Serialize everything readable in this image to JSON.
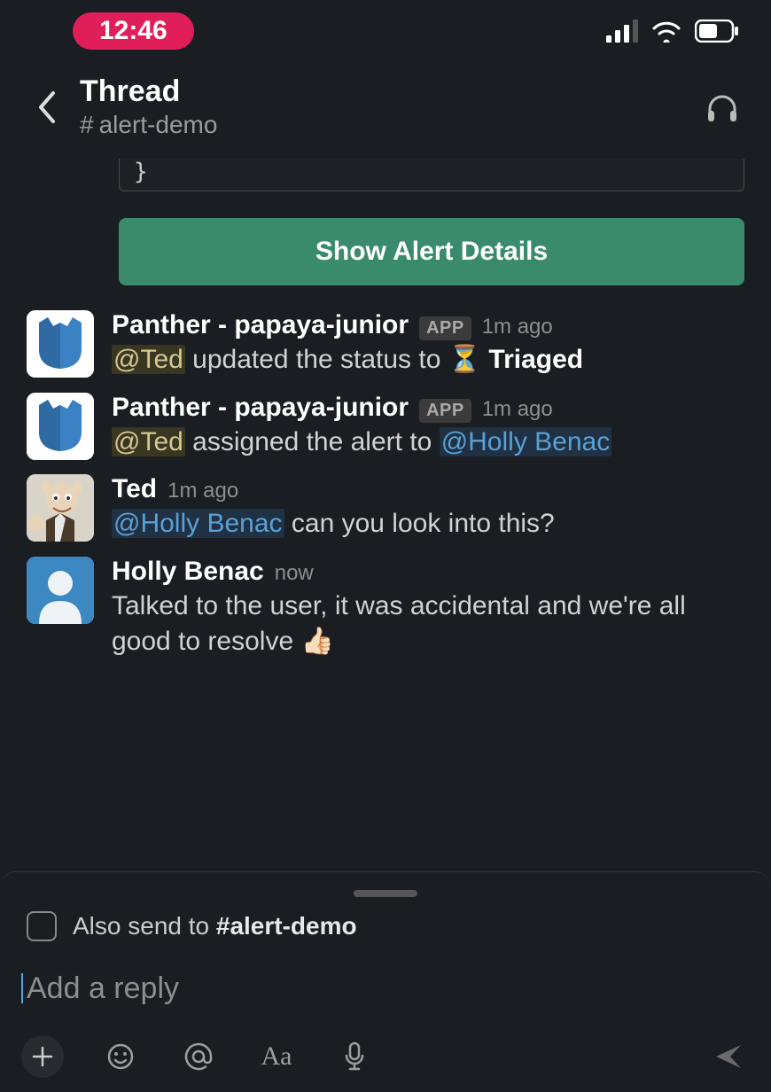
{
  "status": {
    "time": "12:46"
  },
  "header": {
    "title": "Thread",
    "hash": "#",
    "channel": "alert-demo"
  },
  "code_tail": "}",
  "alert_button": "Show Alert Details",
  "messages": [
    {
      "author": "Panther - papaya-junior",
      "app": "APP",
      "ts": "1m ago",
      "avatar": "panther",
      "parts": [
        {
          "type": "mention-brown",
          "text": "@Ted"
        },
        {
          "type": "text",
          "text": " updated the status to "
        },
        {
          "type": "emoji",
          "text": "⏳"
        },
        {
          "type": "text",
          "text": " "
        },
        {
          "type": "bold",
          "text": "Triaged"
        }
      ]
    },
    {
      "author": "Panther - papaya-junior",
      "app": "APP",
      "ts": "1m ago",
      "avatar": "panther",
      "parts": [
        {
          "type": "mention-brown",
          "text": "@Ted"
        },
        {
          "type": "text",
          "text": " assigned the alert to "
        },
        {
          "type": "mention-blue",
          "text": "@Holly Benac"
        }
      ]
    },
    {
      "author": "Ted",
      "ts": "1m ago",
      "avatar": "ted",
      "parts": [
        {
          "type": "mention-blue",
          "text": "@Holly Benac"
        },
        {
          "type": "text",
          "text": " can you look into this?"
        }
      ]
    },
    {
      "author": "Holly Benac",
      "ts": "now",
      "avatar": "holly",
      "parts": [
        {
          "type": "text",
          "text": "Talked to the user, it was accidental and we're all good to resolve "
        },
        {
          "type": "emoji",
          "text": "👍🏻"
        }
      ]
    }
  ],
  "composer": {
    "also_send_prefix": "Also send to ",
    "also_send_channel": "#alert-demo",
    "placeholder": "Add a reply"
  }
}
